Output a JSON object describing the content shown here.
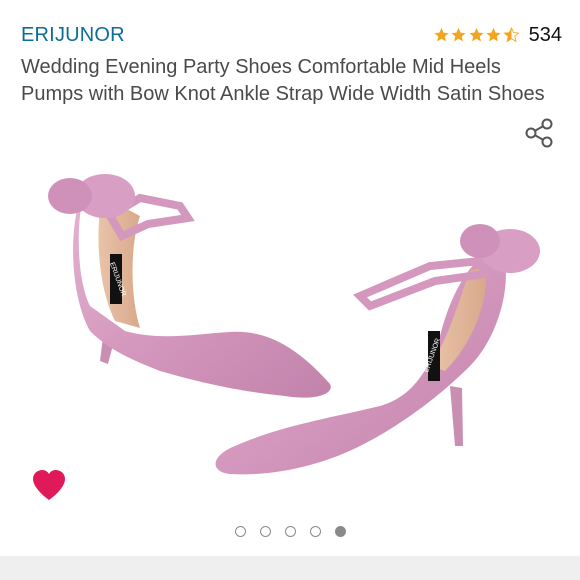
{
  "product": {
    "brand": "ERIJUNOR",
    "title": "Wedding Evening Party Shoes Comfortable Mid Heels Pumps with Bow Knot Ankle Strap Wide Width Satin Shoes",
    "rating": {
      "stars": 4.5,
      "count": "534"
    },
    "image": {
      "brand_label": "ERIJUNOR",
      "shoe_color": "#d9a1c4"
    }
  },
  "carousel": {
    "total": 5,
    "active_index": 4
  },
  "icons": {
    "share": "share-icon",
    "favorite": "heart-icon"
  },
  "colors": {
    "brand_link": "#0a6e99",
    "star": "#f3a51d",
    "heart": "#e0195b",
    "dot": "#8a8a8a"
  }
}
